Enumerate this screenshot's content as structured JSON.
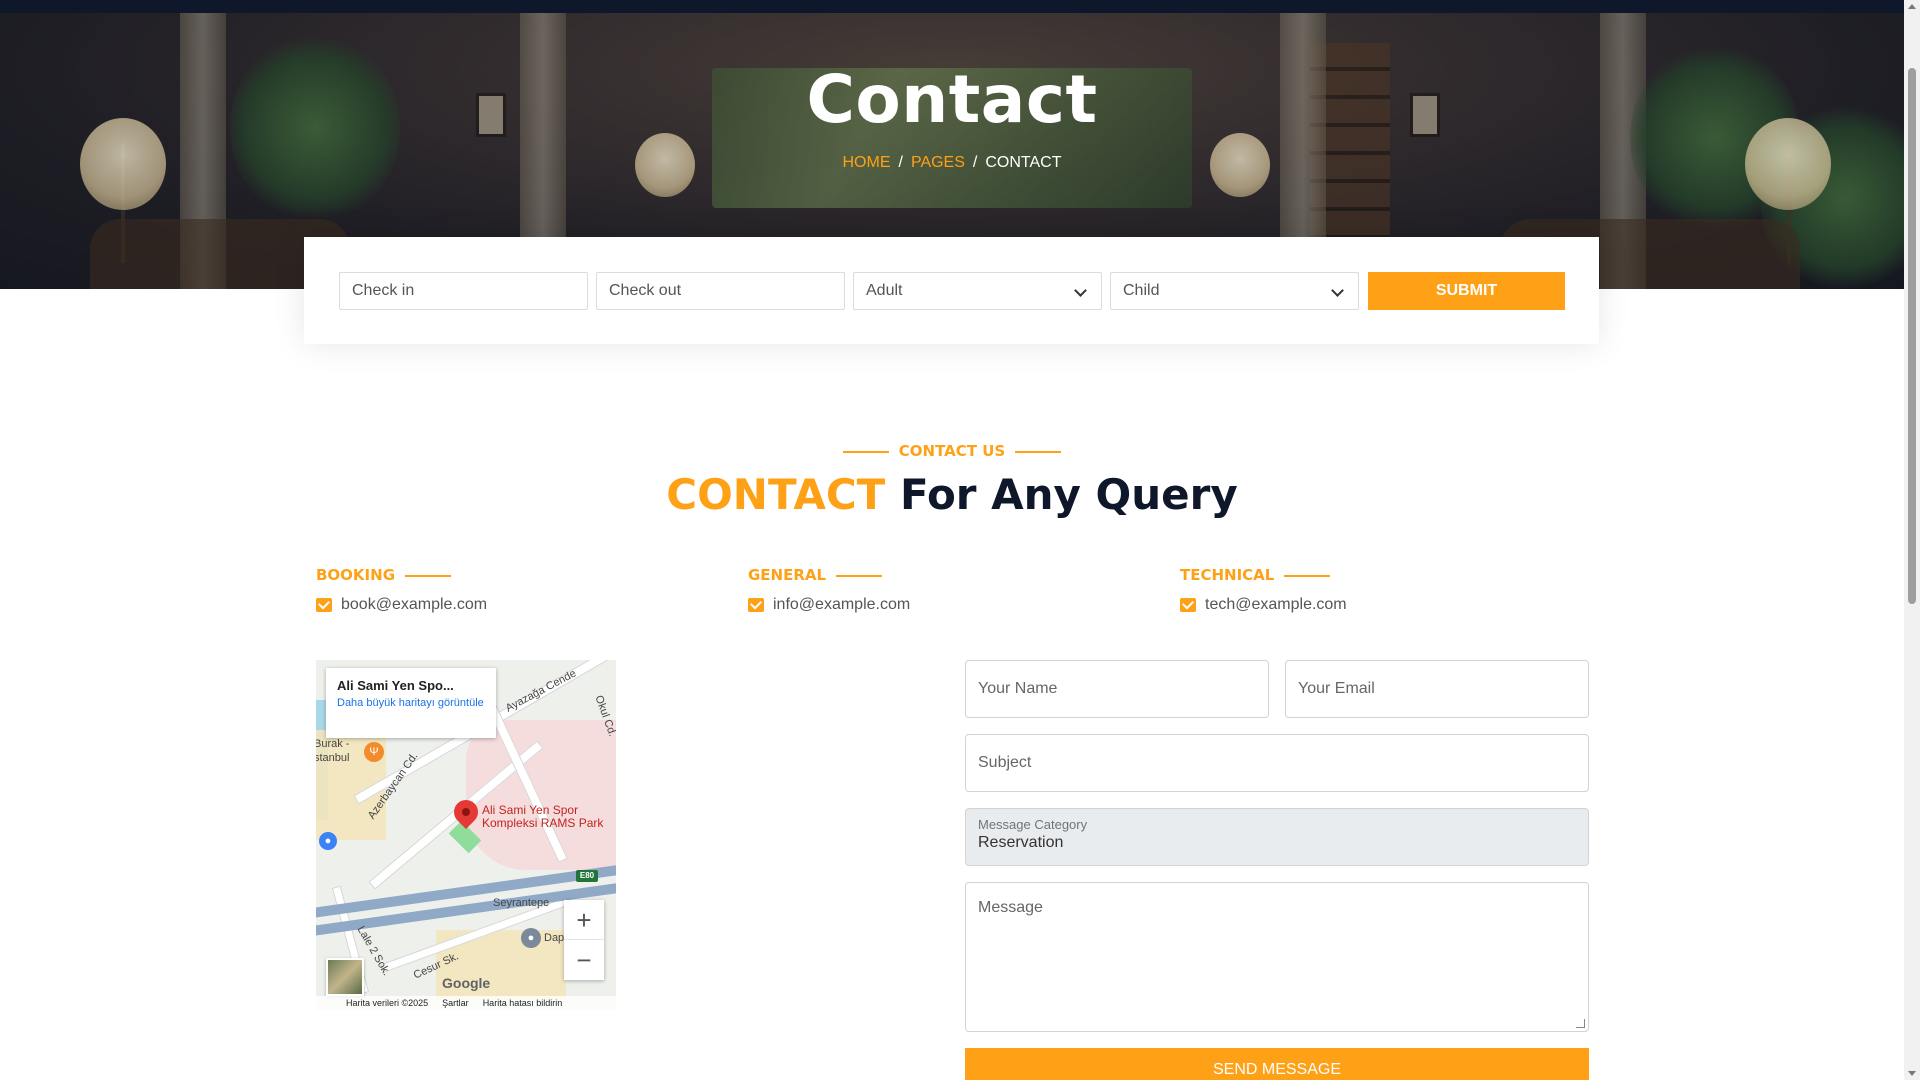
{
  "hero": {
    "title": "Contact",
    "breadcrumb": {
      "home": "HOME",
      "pages": "PAGES",
      "current": "CONTACT",
      "separator": "/"
    }
  },
  "booking": {
    "check_in_placeholder": "Check in",
    "check_out_placeholder": "Check out",
    "adult_selected": "Adult",
    "child_selected": "Child",
    "submit_label": "SUBMIT"
  },
  "section": {
    "eyebrow": "CONTACT US",
    "title_accent": "CONTACT",
    "title_rest": "For Any Query"
  },
  "contacts": [
    {
      "heading": "BOOKING",
      "email": "book@example.com"
    },
    {
      "heading": "GENERAL",
      "email": "info@example.com"
    },
    {
      "heading": "TECHNICAL",
      "email": "tech@example.com"
    }
  ],
  "map": {
    "place_name": "Ali Sami Yen Spo...",
    "larger_map_link": "Daha büyük haritayı görüntüle",
    "pin_label_line1": "Ali Sami Yen Spor",
    "pin_label_line2": "Kompleksi RAMS Park",
    "streets": [
      "Ayazağa Cende",
      "Okul Cd.",
      "Azerbaycan Cd.",
      "Seyrantepe",
      "Lale 2 Sok.",
      "Cesur Sk.",
      "Dap",
      "Burak -",
      "stanbul"
    ],
    "highway_shield": "E80",
    "zoom_in": "+",
    "zoom_out": "−",
    "logo": "Google",
    "footer": {
      "data": "Harita verileri ©2025",
      "terms": "Şartlar",
      "report": "Harita hatası bildirin"
    }
  },
  "form": {
    "name_placeholder": "Your Name",
    "email_placeholder": "Your Email",
    "subject_placeholder": "Subject",
    "category_caption": "Message Category",
    "category_value": "Reservation",
    "message_placeholder": "Message",
    "send_label": "SEND MESSAGE"
  },
  "colors": {
    "accent": "#fea116",
    "dark": "#0f172b"
  }
}
